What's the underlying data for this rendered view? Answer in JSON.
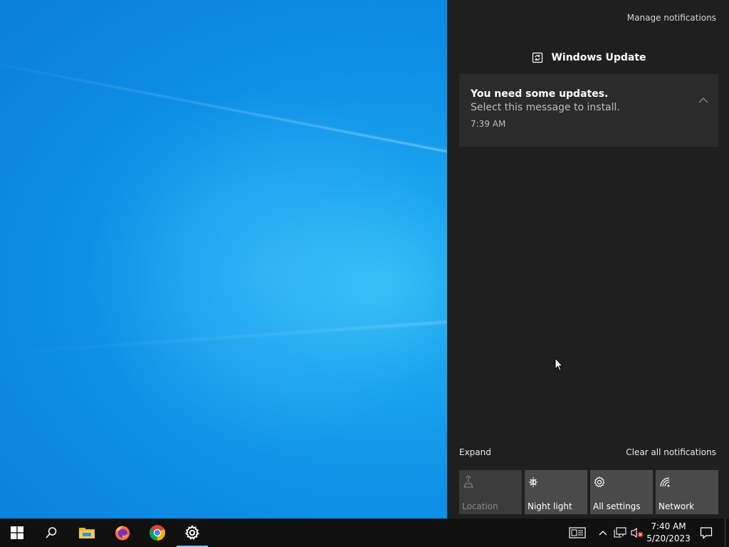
{
  "action_center": {
    "manage_label": "Manage notifications",
    "group_title": "Windows Update",
    "notification": {
      "title": "You need some updates.",
      "body": "Select this message to install.",
      "time": "7:39 AM"
    },
    "expand_label": "Expand",
    "clear_label": "Clear all notifications",
    "quick_actions": [
      {
        "label": "Location",
        "icon": "location-icon",
        "enabled": false
      },
      {
        "label": "Night light",
        "icon": "night-light-icon",
        "enabled": true
      },
      {
        "label": "All settings",
        "icon": "gear-icon",
        "enabled": true
      },
      {
        "label": "Network",
        "icon": "network-icon",
        "enabled": true
      }
    ]
  },
  "taskbar": {
    "apps": [
      "start",
      "search",
      "file-explorer",
      "firefox",
      "chrome",
      "settings"
    ],
    "active_app": "settings",
    "clock": {
      "time": "7:40 AM",
      "date": "5/20/2023"
    }
  },
  "colors": {
    "panel_bg": "#1f1f1f",
    "card_bg": "#2b2b2b",
    "tile_bg": "#4a4a4a",
    "taskbar_bg": "#101010",
    "accent": "#76b9ed",
    "desktop_blue": "#0e8fe6"
  }
}
